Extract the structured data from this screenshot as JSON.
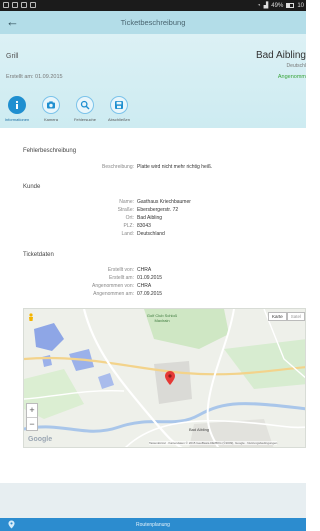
{
  "status_bar": {
    "battery": "49%",
    "time": "10"
  },
  "app_bar": {
    "title": "Ticketbeschreibung"
  },
  "header": {
    "name": "Grill",
    "created": "Erstellt am: 01.09.2015",
    "city": "Bad Aibling",
    "country": "Deutschl",
    "status": "Angenomm"
  },
  "tabs": [
    {
      "label": "Informationen",
      "icon": "info-icon"
    },
    {
      "label": "Kamera",
      "icon": "camera-icon"
    },
    {
      "label": "Fehlersuche",
      "icon": "search-icon"
    },
    {
      "label": "Abschließen",
      "icon": "save-icon"
    }
  ],
  "fehler": {
    "title": "Fehlerbeschreibung",
    "rows": [
      {
        "k": "Beschreibung:",
        "v": "Platte wird nicht mehr richtig heiß."
      }
    ]
  },
  "kunde": {
    "title": "Kunde",
    "rows": [
      {
        "k": "Name:",
        "v": "Gasthaus Kriechbaumer"
      },
      {
        "k": "Straße:",
        "v": "Ebersbergerstr. 72"
      },
      {
        "k": "Ort:",
        "v": "Bad Aibling"
      },
      {
        "k": "PLZ:",
        "v": "83043"
      },
      {
        "k": "Land:",
        "v": "Deutschland"
      }
    ]
  },
  "ticket": {
    "title": "Ticketdaten",
    "rows": [
      {
        "k": "Erstellt von:",
        "v": "CHRA"
      },
      {
        "k": "Erstellt am:",
        "v": "01.09.2015"
      },
      {
        "k": "Angenommen von:",
        "v": "CHRA"
      },
      {
        "k": "Angenommen am:",
        "v": "07.09.2015"
      }
    ]
  },
  "map": {
    "type_map": "Karte",
    "type_sat": "Satel",
    "zoom_in": "+",
    "zoom_out": "−",
    "logo": "Google",
    "attribution": "Tastenkürzel · Kartendaten © 2015 GeoBasis-DE/BKG (©2009), Google · Nutzungsbedingungen",
    "labels": {
      "golf": "Golf Club Schloß Maxlrain",
      "town": "Bad Aibling"
    }
  },
  "bottom": {
    "label": "Routenplanung"
  }
}
